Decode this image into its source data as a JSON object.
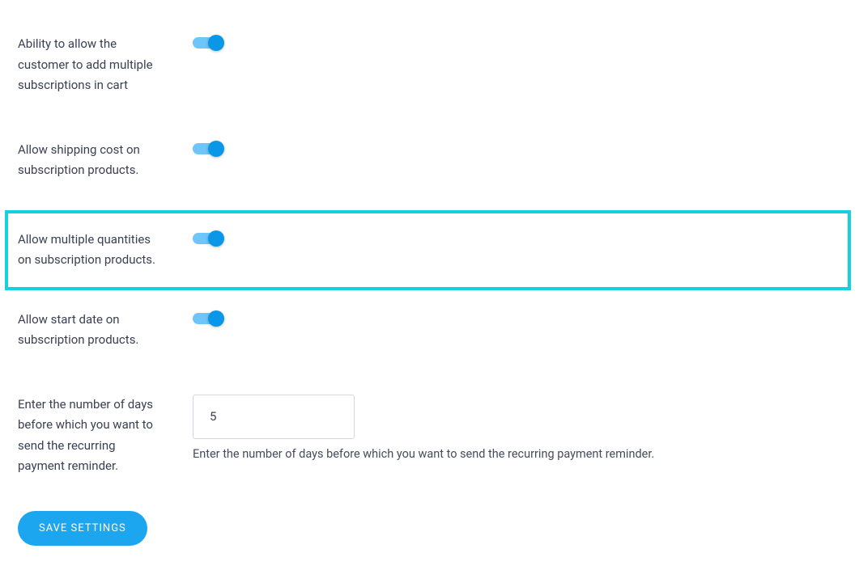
{
  "settings": {
    "multipleSubscriptions": {
      "label": "Ability to allow the customer to add multiple subscriptions in cart",
      "enabled": true
    },
    "shippingCost": {
      "label": "Allow shipping cost on subscription products.",
      "enabled": true
    },
    "multipleQuantities": {
      "label": "Allow multiple quantities on subscription products.",
      "enabled": true,
      "highlighted": true
    },
    "startDate": {
      "label": "Allow start date on subscription products.",
      "enabled": true
    },
    "reminderDays": {
      "label": "Enter the number of days before which you want to send the recurring payment reminder.",
      "value": "5",
      "helpText": "Enter the number of days before which you want to send the recurring payment reminder."
    }
  },
  "buttons": {
    "save": "SAVE SETTINGS"
  }
}
